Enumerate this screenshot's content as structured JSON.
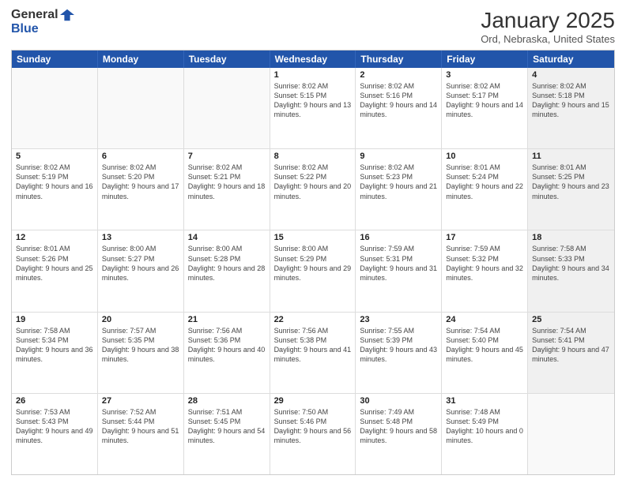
{
  "header": {
    "logo_general": "General",
    "logo_blue": "Blue",
    "month_title": "January 2025",
    "location": "Ord, Nebraska, United States"
  },
  "day_headers": [
    "Sunday",
    "Monday",
    "Tuesday",
    "Wednesday",
    "Thursday",
    "Friday",
    "Saturday"
  ],
  "weeks": [
    [
      {
        "date": "",
        "info": "",
        "empty": true
      },
      {
        "date": "",
        "info": "",
        "empty": true
      },
      {
        "date": "",
        "info": "",
        "empty": true
      },
      {
        "date": "1",
        "info": "Sunrise: 8:02 AM\nSunset: 5:15 PM\nDaylight: 9 hours\nand 13 minutes."
      },
      {
        "date": "2",
        "info": "Sunrise: 8:02 AM\nSunset: 5:16 PM\nDaylight: 9 hours\nand 14 minutes."
      },
      {
        "date": "3",
        "info": "Sunrise: 8:02 AM\nSunset: 5:17 PM\nDaylight: 9 hours\nand 14 minutes."
      },
      {
        "date": "4",
        "info": "Sunrise: 8:02 AM\nSunset: 5:18 PM\nDaylight: 9 hours\nand 15 minutes.",
        "shaded": true
      }
    ],
    [
      {
        "date": "5",
        "info": "Sunrise: 8:02 AM\nSunset: 5:19 PM\nDaylight: 9 hours\nand 16 minutes."
      },
      {
        "date": "6",
        "info": "Sunrise: 8:02 AM\nSunset: 5:20 PM\nDaylight: 9 hours\nand 17 minutes."
      },
      {
        "date": "7",
        "info": "Sunrise: 8:02 AM\nSunset: 5:21 PM\nDaylight: 9 hours\nand 18 minutes."
      },
      {
        "date": "8",
        "info": "Sunrise: 8:02 AM\nSunset: 5:22 PM\nDaylight: 9 hours\nand 20 minutes."
      },
      {
        "date": "9",
        "info": "Sunrise: 8:02 AM\nSunset: 5:23 PM\nDaylight: 9 hours\nand 21 minutes."
      },
      {
        "date": "10",
        "info": "Sunrise: 8:01 AM\nSunset: 5:24 PM\nDaylight: 9 hours\nand 22 minutes."
      },
      {
        "date": "11",
        "info": "Sunrise: 8:01 AM\nSunset: 5:25 PM\nDaylight: 9 hours\nand 23 minutes.",
        "shaded": true
      }
    ],
    [
      {
        "date": "12",
        "info": "Sunrise: 8:01 AM\nSunset: 5:26 PM\nDaylight: 9 hours\nand 25 minutes."
      },
      {
        "date": "13",
        "info": "Sunrise: 8:00 AM\nSunset: 5:27 PM\nDaylight: 9 hours\nand 26 minutes."
      },
      {
        "date": "14",
        "info": "Sunrise: 8:00 AM\nSunset: 5:28 PM\nDaylight: 9 hours\nand 28 minutes."
      },
      {
        "date": "15",
        "info": "Sunrise: 8:00 AM\nSunset: 5:29 PM\nDaylight: 9 hours\nand 29 minutes."
      },
      {
        "date": "16",
        "info": "Sunrise: 7:59 AM\nSunset: 5:31 PM\nDaylight: 9 hours\nand 31 minutes."
      },
      {
        "date": "17",
        "info": "Sunrise: 7:59 AM\nSunset: 5:32 PM\nDaylight: 9 hours\nand 32 minutes."
      },
      {
        "date": "18",
        "info": "Sunrise: 7:58 AM\nSunset: 5:33 PM\nDaylight: 9 hours\nand 34 minutes.",
        "shaded": true
      }
    ],
    [
      {
        "date": "19",
        "info": "Sunrise: 7:58 AM\nSunset: 5:34 PM\nDaylight: 9 hours\nand 36 minutes."
      },
      {
        "date": "20",
        "info": "Sunrise: 7:57 AM\nSunset: 5:35 PM\nDaylight: 9 hours\nand 38 minutes."
      },
      {
        "date": "21",
        "info": "Sunrise: 7:56 AM\nSunset: 5:36 PM\nDaylight: 9 hours\nand 40 minutes."
      },
      {
        "date": "22",
        "info": "Sunrise: 7:56 AM\nSunset: 5:38 PM\nDaylight: 9 hours\nand 41 minutes."
      },
      {
        "date": "23",
        "info": "Sunrise: 7:55 AM\nSunset: 5:39 PM\nDaylight: 9 hours\nand 43 minutes."
      },
      {
        "date": "24",
        "info": "Sunrise: 7:54 AM\nSunset: 5:40 PM\nDaylight: 9 hours\nand 45 minutes."
      },
      {
        "date": "25",
        "info": "Sunrise: 7:54 AM\nSunset: 5:41 PM\nDaylight: 9 hours\nand 47 minutes.",
        "shaded": true
      }
    ],
    [
      {
        "date": "26",
        "info": "Sunrise: 7:53 AM\nSunset: 5:43 PM\nDaylight: 9 hours\nand 49 minutes."
      },
      {
        "date": "27",
        "info": "Sunrise: 7:52 AM\nSunset: 5:44 PM\nDaylight: 9 hours\nand 51 minutes."
      },
      {
        "date": "28",
        "info": "Sunrise: 7:51 AM\nSunset: 5:45 PM\nDaylight: 9 hours\nand 54 minutes."
      },
      {
        "date": "29",
        "info": "Sunrise: 7:50 AM\nSunset: 5:46 PM\nDaylight: 9 hours\nand 56 minutes."
      },
      {
        "date": "30",
        "info": "Sunrise: 7:49 AM\nSunset: 5:48 PM\nDaylight: 9 hours\nand 58 minutes."
      },
      {
        "date": "31",
        "info": "Sunrise: 7:48 AM\nSunset: 5:49 PM\nDaylight: 10 hours\nand 0 minutes."
      },
      {
        "date": "",
        "info": "",
        "empty": true,
        "shaded": true
      }
    ]
  ]
}
